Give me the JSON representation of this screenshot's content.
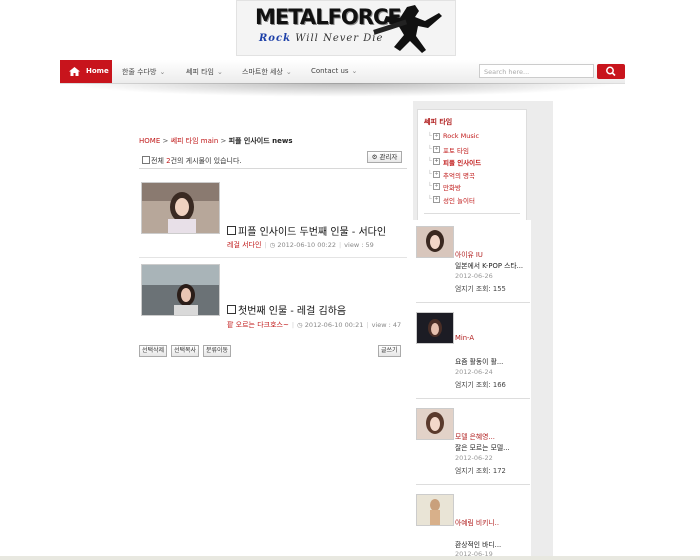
{
  "header": {
    "logo_title": "METALFORCE",
    "logo_slogan_1": "Rock",
    "logo_slogan_2": "Will Never Die"
  },
  "nav": {
    "home_label": "Home",
    "items": [
      {
        "label": "한줄 수다방"
      },
      {
        "label": "쎄피 타임"
      },
      {
        "label": "스마트한 세상"
      },
      {
        "label": "Contact us"
      }
    ],
    "search_placeholder": "Search here..."
  },
  "breadcrumb": {
    "home": "HOME",
    "sep": " > ",
    "section": "쎄피 타임 main",
    "current": "피플 인사이드 news"
  },
  "board": {
    "count_prefix": "전체 ",
    "count": "2",
    "count_suffix": "건의 게시물이 있습니다.",
    "admin_label": "관리자",
    "posts": [
      {
        "title": "피플 인사이드 두번째 인물 - 서다인",
        "author": "레걸 서다인",
        "date": "2012-06-10 00:22",
        "views": "view : 59"
      },
      {
        "title": "첫번째 인물 - 레걸 김하음",
        "author": "팥 오르는 다크호스~",
        "date": "2012-06-10 00:21",
        "views": "view : 47"
      }
    ],
    "buttons": {
      "delete": "선택삭제",
      "copy": "선택복사",
      "move": "분류이동",
      "write": "글쓰기"
    }
  },
  "sidebar": {
    "category_title": "쎄피 타임",
    "categories": [
      "Rock Music",
      "포토 타임",
      "피플 인사이드",
      "추억의 명곡",
      "만화방",
      "성인 놀이터"
    ],
    "items": [
      {
        "name": "아이유 IU",
        "text": "일본에서 K-POP 스타...",
        "date": "2012-06-26",
        "views": "엄지기 조회: 155"
      },
      {
        "name": "Min-A",
        "text": "요즘 활동이 활...",
        "date": "2012-06-24",
        "views": "엄지기 조회: 166"
      },
      {
        "name": "모델 은혜영...",
        "text": "잘은 모르는 모델...",
        "date": "2012-06-22",
        "views": "엄지기 조회: 172"
      },
      {
        "name": "아예림 비키니..",
        "text": "환상적인 바디...",
        "date": "2012-06-19",
        "views": ""
      }
    ]
  },
  "colors": {
    "accent": "#c8141c",
    "link": "#c01818"
  }
}
